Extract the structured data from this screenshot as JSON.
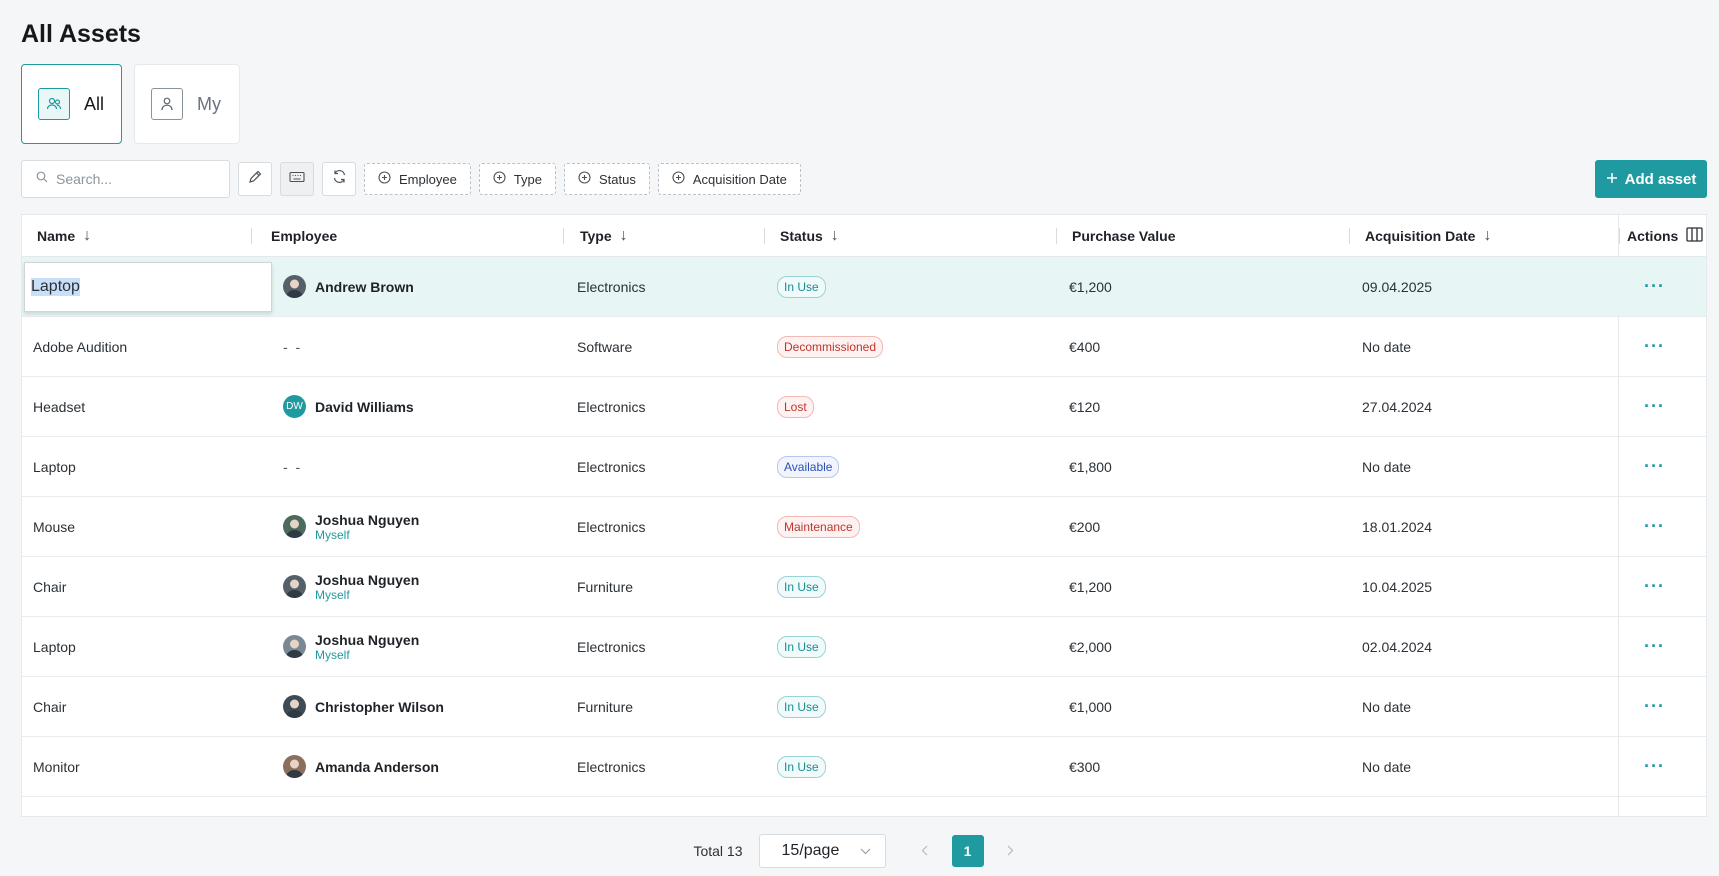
{
  "page": {
    "title": "All Assets"
  },
  "tabs": [
    {
      "label": "All",
      "icon": "users-icon",
      "active": true
    },
    {
      "label": "My",
      "icon": "user-icon",
      "active": false
    }
  ],
  "toolbar": {
    "search_placeholder": "Search...",
    "filters": [
      "Employee",
      "Type",
      "Status",
      "Acquisition Date"
    ],
    "add_label": "Add asset"
  },
  "columns": {
    "name": "Name",
    "employee": "Employee",
    "type": "Type",
    "status": "Status",
    "purchase_value": "Purchase Value",
    "acquisition_date": "Acquisition Date",
    "actions": "Actions"
  },
  "rows": [
    {
      "name": "Laptop",
      "employee": "Andrew Brown",
      "employee_sub": "",
      "type": "Electronics",
      "status": "In Use",
      "value": "€1,200",
      "date": "09.04.2025"
    },
    {
      "name": "Adobe Audition",
      "employee": "- -",
      "employee_sub": "",
      "type": "Software",
      "status": "Decommissioned",
      "value": "€400",
      "date": "No date"
    },
    {
      "name": "Headset",
      "employee": "David Williams",
      "employee_sub": "",
      "avatar_initials": "DW",
      "type": "Electronics",
      "status": "Lost",
      "value": "€120",
      "date": "27.04.2024"
    },
    {
      "name": "Laptop",
      "employee": "- -",
      "employee_sub": "",
      "type": "Electronics",
      "status": "Available",
      "value": "€1,800",
      "date": "No date"
    },
    {
      "name": "Mouse",
      "employee": "Joshua Nguyen",
      "employee_sub": "Myself",
      "type": "Electronics",
      "status": "Maintenance",
      "value": "€200",
      "date": "18.01.2024"
    },
    {
      "name": "Chair",
      "employee": "Joshua Nguyen",
      "employee_sub": "Myself",
      "type": "Furniture",
      "status": "In Use",
      "value": "€1,200",
      "date": "10.04.2025"
    },
    {
      "name": "Laptop",
      "employee": "Joshua Nguyen",
      "employee_sub": "Myself",
      "type": "Electronics",
      "status": "In Use",
      "value": "€2,000",
      "date": "02.04.2024"
    },
    {
      "name": "Chair",
      "employee": "Christopher Wilson",
      "employee_sub": "",
      "type": "Furniture",
      "status": "In Use",
      "value": "€1,000",
      "date": "No date"
    },
    {
      "name": "Monitor",
      "employee": "Amanda Anderson",
      "employee_sub": "",
      "type": "Electronics",
      "status": "In Use",
      "value": "€300",
      "date": "No date"
    }
  ],
  "pagination": {
    "total_label": "Total 13",
    "page_size": "15/page",
    "current_page": "1"
  },
  "colors": {
    "accent": "#1f9aa0",
    "selected_row": "#e8f5f5"
  }
}
